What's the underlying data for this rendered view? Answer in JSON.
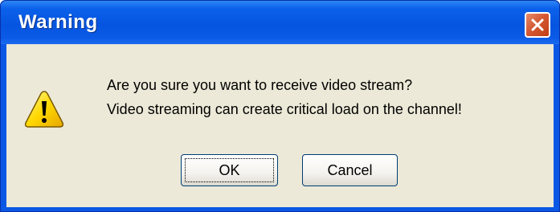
{
  "window": {
    "title": "Warning",
    "close_icon": "close-icon",
    "colors": {
      "titlebar": "#0655e0",
      "close_button": "#d45933",
      "client": "#ece9d8"
    }
  },
  "dialog": {
    "icon": "warning-icon",
    "message_lines": [
      "Are you sure you want to receive video stream?",
      "Video streaming can create critical load on the channel!"
    ],
    "buttons": {
      "ok_label": "OK",
      "cancel_label": "Cancel"
    }
  }
}
